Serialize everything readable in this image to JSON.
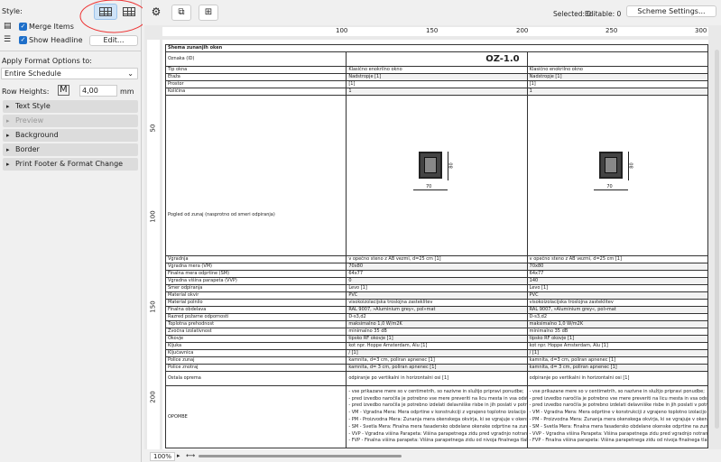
{
  "left": {
    "style_label": "Style:",
    "merge_items": "Merge Items",
    "show_headline": "Show Headline",
    "edit": "Edit...",
    "apply_label": "Apply Format Options to:",
    "apply_value": "Entire Schedule",
    "row_heights_label": "Row Heights:",
    "row_height": "4,00",
    "unit": "mm",
    "sections": [
      "Text Style",
      "Preview",
      "Background",
      "Border",
      "Print Footer & Format Change"
    ]
  },
  "top": {
    "selected": "Selected: 0",
    "editable": "Editable: 0",
    "scheme": "Scheme Settings..."
  },
  "ruler_h": [
    "50",
    "100",
    "150",
    "200",
    "250",
    "300"
  ],
  "ruler_v": [
    "50",
    "100",
    "150",
    "200"
  ],
  "schedule": {
    "title": "Shema zunanjih oken",
    "id_label": "Oznaka (ID)",
    "id_value": "OZ-1.0",
    "view_label": "Pogled od zunaj (nasprotno od smeri odpiranja)",
    "dim_w": "70",
    "dim_h": "80",
    "rows": [
      [
        "Tip okna",
        "Klasično enokrilno okno",
        "Klasično enokrilno okno"
      ],
      [
        "Etaža",
        "Nadstropje [1]",
        "Nadstropje [1]"
      ],
      [
        "Prostor",
        " [1]",
        " [1]"
      ],
      [
        "Količina",
        "1",
        "1"
      ]
    ],
    "rows2": [
      [
        "Vgradnja",
        "v opečno steno z AB vezmi, d=25 cm [1]",
        "v opečno steno z AB vezmi, d=25 cm [1]"
      ],
      [
        "Vgradna mera (VM)",
        "70x80",
        "70x80"
      ],
      [
        "Finalna mera odprtine (SM)",
        "64x77",
        "64x77"
      ],
      [
        "Vgradna višina parapeta (VVP)",
        "0",
        "140"
      ],
      [
        "Smer odpiranja",
        "Levo [1]",
        "Levo [1]"
      ],
      [
        "Material okvir",
        "PVC",
        "PVC"
      ],
      [
        "Material polnilo",
        "visokoizolacijska troslojna zasteklitev",
        "visokoizolacijska troslojna zasteklitev"
      ],
      [
        "Finalna obdelava",
        "RAL 9007, »Aluminium grey«, pol»mat",
        "RAL 9007, »Aluminium grey«, pol»mat"
      ],
      [
        "Razred požarne odpornosti",
        "D-s3,d2",
        "D-s3,d2"
      ],
      [
        "Toplotna prehodnost",
        "maksimalno 1,0 W/m2K",
        "maksimalno 1,0 W/m2K"
      ],
      [
        "Zvočna izolativnost",
        "minimalno 35 dB",
        "minimalno 35 dB"
      ],
      [
        "Okovje",
        "tipsko RF okovje [1]",
        "tipsko RF okovje [1]"
      ],
      [
        "Kljuka",
        "kot npr. Hoppe Amsterdam, Alu [1]",
        "kot npr. Hoppe Amsterdam, Alu [1]"
      ],
      [
        "Ključavnica",
        "/ [1]",
        "/ [1]"
      ],
      [
        "Police zunaj",
        "kamnita, d=3 cm, poliran apnenec [1]",
        "kamnita, d=3 cm, poliran apnenec [1]"
      ],
      [
        "Police znotraj",
        "kamnita, d= 3 cm, poliran apnenec [1]",
        "kamnita, d= 3 cm, poliran apnenec [1]"
      ],
      [
        "Ostala oprema",
        "odpiranje po vertikalni in horizontalni osi [1]",
        "odpiranje po vertikalni in horizontalni osi [1]"
      ]
    ],
    "notes_label": "OPOMBE",
    "notes": [
      "- vse prikazane mere so v centimetrih, so nazivne in služijo pripravi ponudbe;",
      "- pred izvedbo naročila je potrebno vse mere preveriti na licu mesta in vsa odstopanja javiti projektantu;",
      "- pred izvedbo naročila je potrebno izdelati delavniške risbe in jih poslati v potrditev projektantu;",
      "- VM - Vgradna Mera: Mera odprtine v konstrukciji z vgrajeno toplotno izolacijo špalete;",
      "- PM - Proizvodna Mera: Zunanja mera okenskega okvirja, ki se vgrajuje v okensko odprtino;",
      "- SM - Svetla Mera: Finalna mera fasadersko obdelane okenske odprtine na zunanji strani;",
      "- VVP - Vgradna višina Parapeta: Višina parapetnega zidu pred vgradnjo notranje okenske police;",
      "- FVP - Finalna višina parapeta: Višina parapetnega zidu od nivoja finalnega tlaka do zgornje ploskve police."
    ]
  },
  "status": {
    "zoom": "100%"
  }
}
